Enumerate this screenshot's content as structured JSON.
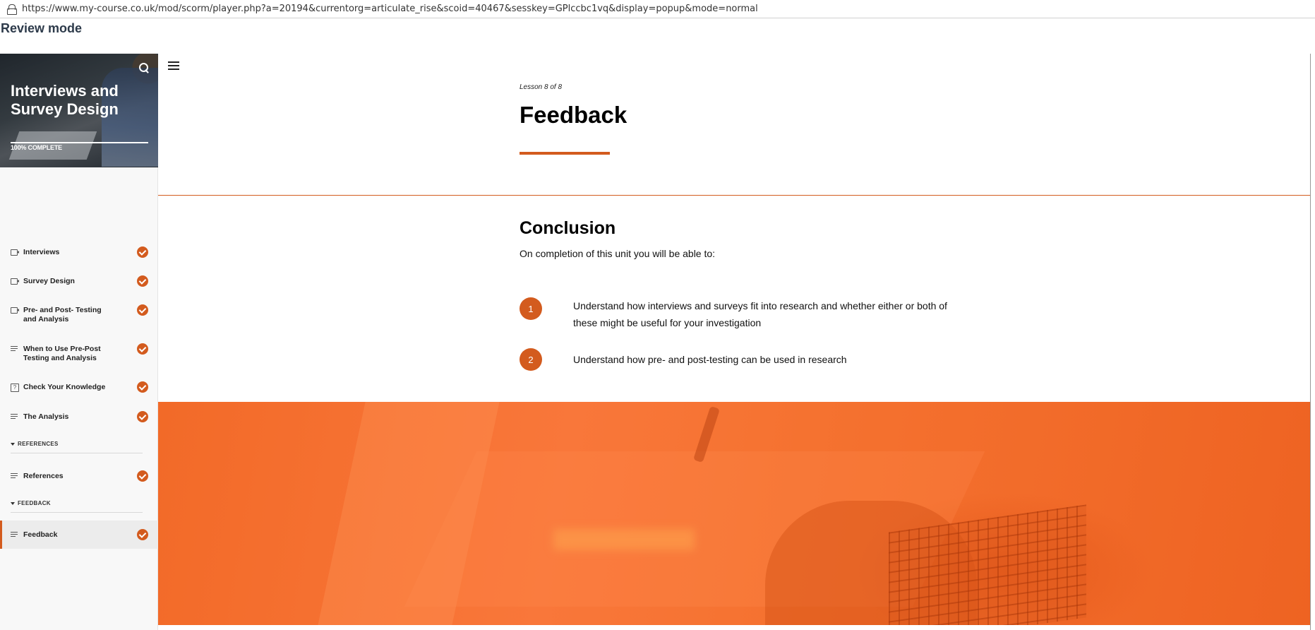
{
  "browser": {
    "url": "https://www.my-course.co.uk/mod/scorm/player.php?a=20194&currentorg=articulate_rise&scoid=40467&sesskey=GPlccbc1vq&display=popup&mode=normal"
  },
  "page": {
    "mode_label": "Review mode"
  },
  "sidebar": {
    "course_title": "Interviews and Survey Design",
    "progress_label": "100% COMPLETE",
    "progress_fraction": 1.0,
    "items": [
      {
        "label": "Interviews",
        "icon": "video-icon",
        "completed": true
      },
      {
        "label": "Survey Design",
        "icon": "video-icon",
        "completed": true
      },
      {
        "label": "Pre- and Post- Testing and Analysis",
        "icon": "video-icon",
        "completed": true
      },
      {
        "label": "When to Use Pre-Post Testing and Analysis",
        "icon": "text-lines-icon",
        "completed": true
      },
      {
        "label": "Check Your Knowledge",
        "icon": "quiz-icon",
        "completed": true
      },
      {
        "label": "The Analysis",
        "icon": "text-lines-icon",
        "completed": true
      },
      {
        "label": "References",
        "icon": "text-lines-icon",
        "completed": true
      },
      {
        "label": "Feedback",
        "icon": "text-lines-icon",
        "completed": true,
        "active": true
      }
    ],
    "sections": [
      {
        "label": "REFERENCES"
      },
      {
        "label": "FEEDBACK"
      }
    ]
  },
  "lesson": {
    "counter": "Lesson 8 of 8",
    "title": "Feedback"
  },
  "content": {
    "heading": "Conclusion",
    "intro": "On completion of this unit you will be able to:",
    "list": [
      {
        "number": "1",
        "text": "Understand how interviews and surveys fit into research and whether either or both of these might be useful for your investigation"
      },
      {
        "number": "2",
        "text": "Understand how pre- and post-testing can be used in research"
      }
    ]
  },
  "colors": {
    "accent": "#d35b1e",
    "banner": "#f57230"
  }
}
